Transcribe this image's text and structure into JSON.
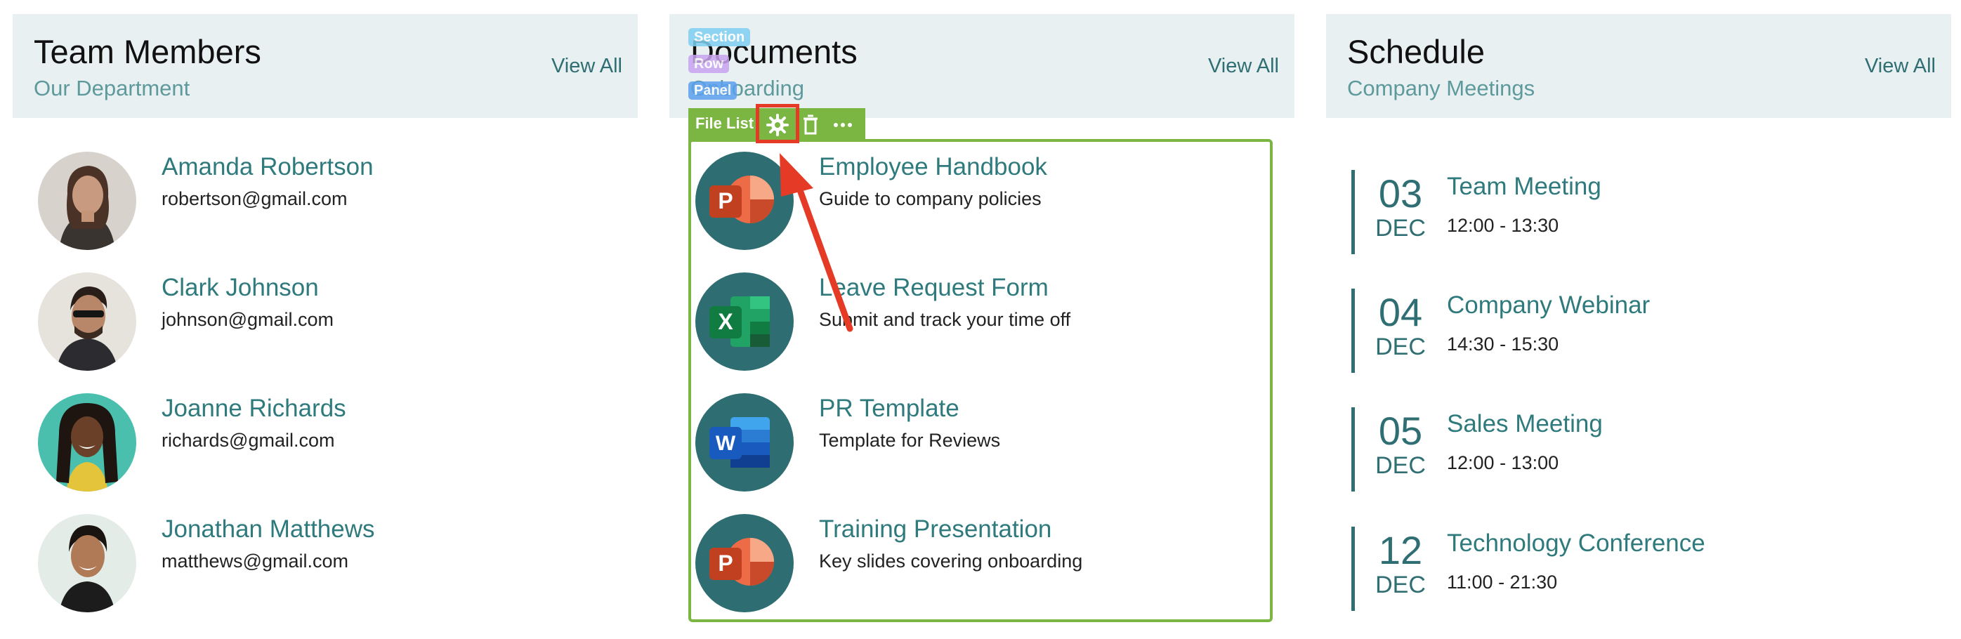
{
  "team": {
    "title": "Team Members",
    "subtitle": "Our Department",
    "view_all": "View All",
    "members": [
      {
        "name": "Amanda Robertson",
        "email": "robertson@gmail.com"
      },
      {
        "name": "Clark Johnson",
        "email": "johnson@gmail.com"
      },
      {
        "name": "Joanne Richards",
        "email": "richards@gmail.com"
      },
      {
        "name": "Jonathan Matthews",
        "email": "matthews@gmail.com"
      }
    ]
  },
  "documents": {
    "title": "Documents",
    "subtitle": "Onboarding",
    "view_all": "View All",
    "files": [
      {
        "name": "Employee Handbook",
        "desc": "Guide to company policies",
        "icon": "powerpoint-icon",
        "letter": "P"
      },
      {
        "name": "Leave Request Form",
        "desc": "Submit and track your time off",
        "icon": "excel-icon",
        "letter": "X"
      },
      {
        "name": "PR Template",
        "desc": "Template for Reviews",
        "icon": "word-icon",
        "letter": "W"
      },
      {
        "name": "Training Presentation",
        "desc": "Key slides covering onboarding",
        "icon": "powerpoint-icon",
        "letter": "P"
      }
    ]
  },
  "schedule": {
    "title": "Schedule",
    "subtitle": "Company Meetings",
    "view_all": "View All",
    "events": [
      {
        "day": "03",
        "month": "DEC",
        "title": "Team Meeting",
        "time": "12:00 - 13:30"
      },
      {
        "day": "04",
        "month": "DEC",
        "title": "Company Webinar",
        "time": "14:30 - 15:30"
      },
      {
        "day": "05",
        "month": "DEC",
        "title": "Sales Meeting",
        "time": "12:00 - 13:00"
      },
      {
        "day": "12",
        "month": "DEC",
        "title": "Technology Conference",
        "time": "11:00 - 21:30"
      }
    ]
  },
  "editor": {
    "tags": {
      "section": "Section",
      "row": "Row",
      "panel": "Panel"
    },
    "toolbar_label": "File List"
  },
  "colors": {
    "accent": "#2f7a7c",
    "header_bg": "#e8f0f2",
    "editor_green": "#7bb542",
    "highlight_red": "#e53b26",
    "tag_section": "#7fd0f2",
    "tag_row": "#c9a3f0",
    "tag_panel": "#5aa0ee"
  }
}
